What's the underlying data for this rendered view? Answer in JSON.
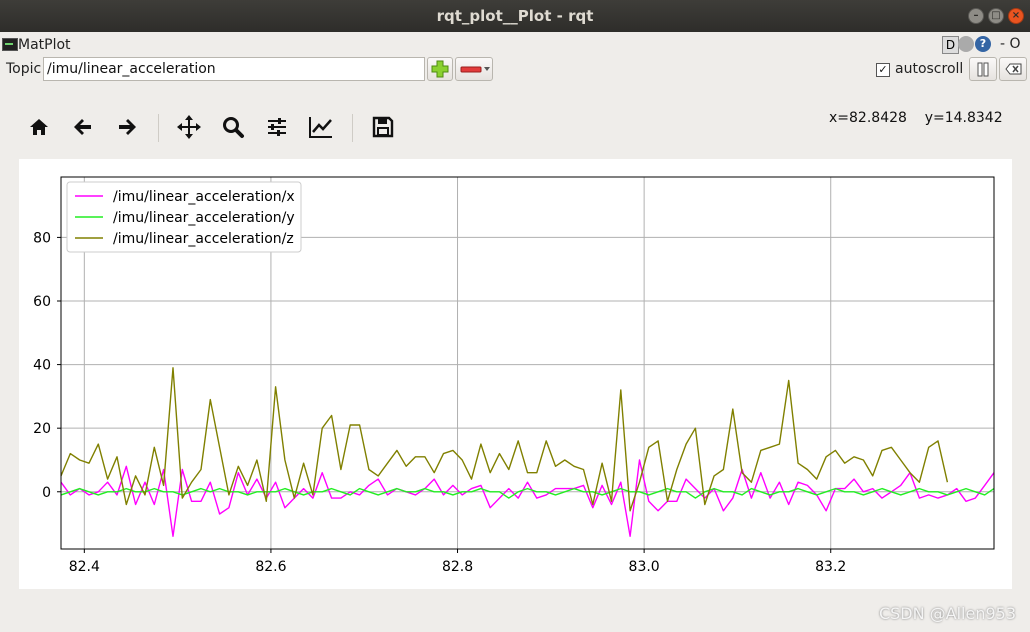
{
  "window": {
    "title": "rqt_plot__Plot - rqt"
  },
  "plugin": {
    "title": "MatPlot",
    "help_label": "D",
    "extra_label": "- O"
  },
  "topic": {
    "label": "Topic",
    "value": "/imu/linear_acceleration"
  },
  "autoscroll": {
    "label": "autoscroll",
    "checked": true
  },
  "toolbar": {
    "icons": [
      "home-icon",
      "back-icon",
      "forward-icon",
      "pan-icon",
      "zoom-icon",
      "configure-subplots-icon",
      "edit-axis-icon",
      "save-icon"
    ]
  },
  "coords": {
    "text": "x=82.8428    y=14.8342"
  },
  "watermark": {
    "text": "CSDN @Allen953"
  },
  "chart_data": {
    "type": "line",
    "xlim": [
      82.375,
      83.375
    ],
    "ylim": [
      -18,
      99
    ],
    "x_ticks": [
      82.4,
      82.6,
      82.8,
      83.0,
      83.2
    ],
    "x_tick_labels": [
      "82.4",
      "82.6",
      "82.8",
      "83.0",
      "83.2"
    ],
    "y_ticks": [
      0,
      20,
      40,
      60,
      80
    ],
    "y_tick_labels": [
      "0",
      "20",
      "40",
      "60",
      "80"
    ],
    "grid": true,
    "legend_position": "upper-left",
    "x_start": 82.375,
    "x_step": 0.01,
    "series": [
      {
        "name": "/imu/linear_acceleration/x",
        "color": "#ff00ff",
        "values": [
          3,
          -1,
          1,
          -1,
          0,
          3,
          -1,
          8,
          -4,
          3,
          -4,
          7,
          -14,
          7,
          -3,
          -3,
          3,
          -7,
          -5,
          6,
          -1,
          4,
          -2,
          3,
          -5,
          -2,
          1,
          -2,
          6,
          -2,
          -2,
          0,
          -1,
          2,
          4,
          -1,
          1,
          0,
          -1,
          1,
          4,
          -1,
          2,
          -1,
          1,
          2,
          -5,
          -2,
          1,
          -2,
          3,
          -2,
          -1,
          1,
          1,
          1,
          2,
          -5,
          2,
          -4,
          3,
          -14,
          10,
          -3,
          -6,
          -3,
          -3,
          4,
          1,
          -2,
          1,
          -6,
          -2,
          7,
          -2,
          6,
          -2,
          3,
          -4,
          3,
          2,
          -1,
          -6,
          1,
          1,
          4,
          0,
          1,
          -2,
          0,
          2,
          6,
          -2,
          -1,
          -2,
          -1,
          1,
          -3,
          -2,
          2,
          6
        ]
      },
      {
        "name": "/imu/linear_acceleration/y",
        "color": "#22ee22",
        "values": [
          -1,
          0,
          1,
          0,
          -1,
          0,
          0,
          1,
          0,
          0,
          1,
          0,
          0,
          -1,
          0,
          1,
          0,
          1,
          0,
          0,
          -1,
          0,
          0,
          0,
          1,
          0,
          -1,
          0,
          0,
          1,
          0,
          -1,
          1,
          0,
          -1,
          0,
          1,
          0,
          0,
          1,
          0,
          0,
          -1,
          0,
          0,
          1,
          0,
          0,
          -2,
          0,
          1,
          0,
          0,
          -1,
          0,
          1,
          0,
          0,
          -1,
          0,
          1,
          0,
          0,
          -1,
          0,
          1,
          0,
          0,
          -2,
          0,
          1,
          0,
          0,
          -1,
          1,
          0,
          -1,
          0,
          0,
          1,
          0,
          -1,
          0,
          1,
          0,
          0,
          -1,
          0,
          1,
          0,
          -1,
          0,
          1,
          0,
          0,
          -1,
          0,
          1,
          0,
          -1,
          1
        ]
      },
      {
        "name": "/imu/linear_acceleration/z",
        "color": "#808000",
        "values": [
          5,
          12,
          10,
          9,
          15,
          4,
          11,
          -4,
          5,
          -1,
          14,
          2,
          39,
          -2,
          3,
          7,
          29,
          14,
          -1,
          8,
          2,
          10,
          -3,
          33,
          10,
          -2,
          9,
          -1,
          20,
          24,
          7,
          21,
          21,
          7,
          5,
          9,
          13,
          8,
          11,
          11,
          6,
          12,
          13,
          10,
          4,
          15,
          6,
          12,
          7,
          16,
          6,
          6,
          16,
          8,
          10,
          8,
          7,
          -4,
          9,
          -3,
          32,
          -6,
          3,
          14,
          16,
          -3,
          7,
          15,
          20,
          -4,
          5,
          7,
          26,
          6,
          3,
          13,
          14,
          15,
          35,
          9,
          7,
          4,
          11,
          13,
          9,
          11,
          10,
          5,
          13,
          14,
          10,
          6,
          3,
          14,
          16,
          3
        ]
      }
    ]
  }
}
